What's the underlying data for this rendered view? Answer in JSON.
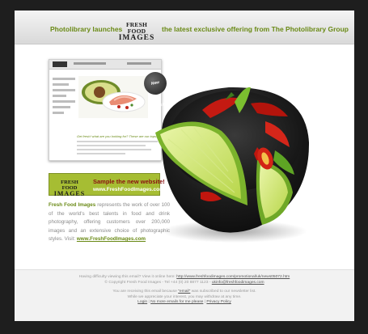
{
  "header": {
    "text_left": "Photolibrary launches",
    "logo_line1": "FRESH FOOD",
    "logo_line2": "IMAGES",
    "text_right": "the latest exclusive offering from The Photolibrary Group"
  },
  "thumbnail": {
    "badge": "New Website!",
    "tagline": "Get fresh! what are you looking for? These are our tops!"
  },
  "banner": {
    "logo_line1": "FRESH FOOD",
    "logo_line2": "IMAGES",
    "title": "Sample the new website!",
    "url": "www.FreshFoodImages.com"
  },
  "body": {
    "brand": "Fresh Food Images",
    "text": " represents the work of over 100 of the world's best talents in food and drink photography, offering customers over 200,000 images and an extensive choice of photographic styles. Visit: ",
    "link": "www.FreshFoodImages.com"
  },
  "footer": {
    "line1_text": "Having difficulty viewing this email? View it online here: ",
    "line1_link": "http://www.freshfoodimages.com/promotional/uk/news05072.htm",
    "line2_text": "© Copyright Fresh Food Images - Tel +44 (0) 20 8877 1123 - ",
    "line2_link": "ukinfo@freshfoodimages.com",
    "line3_text_a": "You are receiving this email because ",
    "line3_link": "\"email\"",
    "line3_text_b": " was subscribed to our newsletter list.",
    "line4": "While we appreciate your interest, you may withdraw at any time.",
    "link_login": "Login",
    "link_no_emails": "No more emails for me please",
    "link_privacy": "Privacy Policy",
    "separator": " | "
  },
  "colors": {
    "accent_green": "#6a8a16",
    "banner_green": "#a6bd33",
    "banner_title_red": "#8a1010"
  }
}
